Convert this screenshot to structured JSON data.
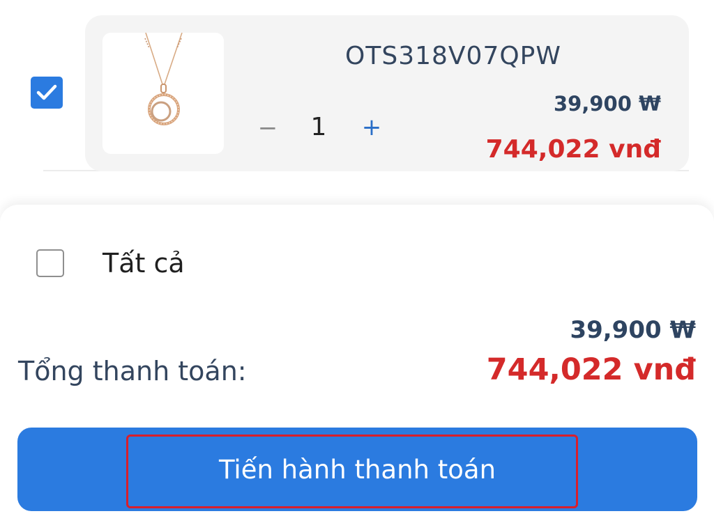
{
  "cart_item": {
    "checked": true,
    "product_code": "OTS318V07QPW",
    "quantity": "1",
    "minus_label": "−",
    "plus_label": "+",
    "price_krw": "39,900 ₩",
    "price_vnd": "744,022 vnđ",
    "image_icon": "pendant-necklace-image"
  },
  "summary": {
    "select_all_label": "Tất cả",
    "select_all_checked": false,
    "total_label": "Tổng thanh toán:",
    "total_krw": "39,900 ₩",
    "total_vnd": "744,022 vnđ"
  },
  "checkout": {
    "button_label": "Tiến hành thanh toán"
  },
  "colors": {
    "accent": "#2b7be0",
    "price_red": "#d42a2a",
    "price_navy": "#2e4461",
    "highlight": "#d81f2c"
  }
}
